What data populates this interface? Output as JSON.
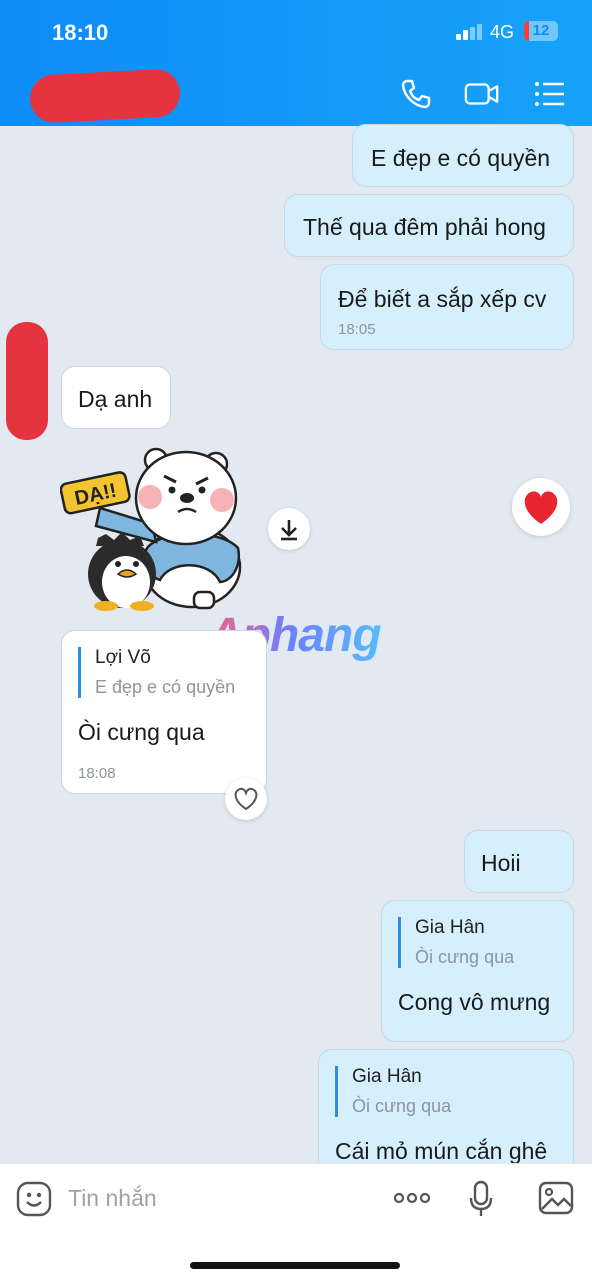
{
  "status_bar": {
    "time": "18:10",
    "network": "4G",
    "battery": "12"
  },
  "header": {
    "contact_name_redacted": true,
    "actions": [
      {
        "name": "call-icon",
        "label": "call"
      },
      {
        "name": "video-call-icon",
        "label": "video call"
      },
      {
        "name": "menu-icon",
        "label": "options"
      }
    ]
  },
  "messages": [
    {
      "dir": "out",
      "text": "E đẹp e có quyền"
    },
    {
      "dir": "out",
      "text": "Thế qua đêm phải hong"
    },
    {
      "dir": "out",
      "text": "Để biết a sắp xếp cv",
      "time": "18:05"
    },
    {
      "dir": "in",
      "text": "Dạ anh"
    },
    {
      "dir": "in",
      "type": "sticker",
      "sticker_text": "DẠ!!",
      "reaction": "heart"
    },
    {
      "dir": "in",
      "reply_name": "Lợi Võ",
      "reply_text": "E đẹp e có quyền",
      "text": "Òi cưng qua",
      "time": "18:08"
    },
    {
      "dir": "out",
      "text": "Hoii"
    },
    {
      "dir": "out",
      "reply_name": "Gia Hân",
      "reply_text": "Òi cưng qua",
      "text": "Cong vô mưng"
    },
    {
      "dir": "out",
      "reply_name": "Gia Hân",
      "reply_text": "Òi cưng qua",
      "text": "Cái mỏ mún cắn ghê"
    }
  ],
  "watermark": "Aphang",
  "composer": {
    "placeholder": "Tin nhắn"
  },
  "colors": {
    "header": "#0e8cf7",
    "outgoing_bubble": "#d5effd",
    "incoming_bubble": "#ffffff",
    "background": "#e2e9f1",
    "quote_bar": "#2f8dde"
  }
}
